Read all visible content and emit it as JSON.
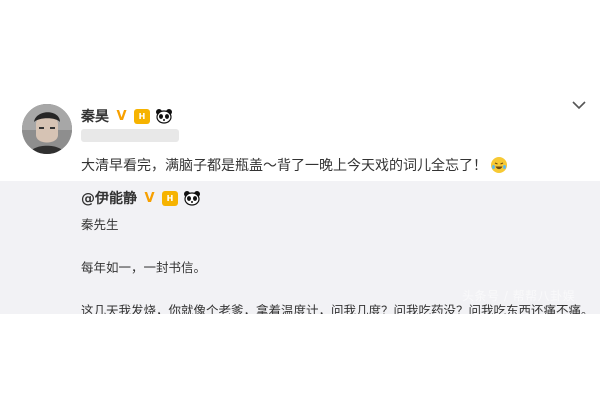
{
  "post": {
    "author": "秦昊",
    "verified_badge": "V",
    "crown_badge": "H",
    "text": "大清早看完，满脑子都是瓶盖～背了一晚上今天戏的词儿全忘了！",
    "emoji_icon": "laugh-cry-icon"
  },
  "repost": {
    "author": "@伊能静",
    "verified_badge": "V",
    "crown_badge": "H",
    "lines": [
      "秦先生",
      "每年如一，一封书信。",
      "这几天我发烧，你就像个老爹，拿着温度计，问我几度？问我吃药没？问我吃东西还痛不痛。"
    ]
  },
  "watermark": "头条号 / 帮帮八卦娱",
  "icons": {
    "avatar": "avatar",
    "menu": "chevron-down-icon",
    "panda": "panda-icon"
  },
  "colors": {
    "repost_background": "#f2f2f5",
    "badge_gold": "#f6b300",
    "text": "#333333"
  }
}
